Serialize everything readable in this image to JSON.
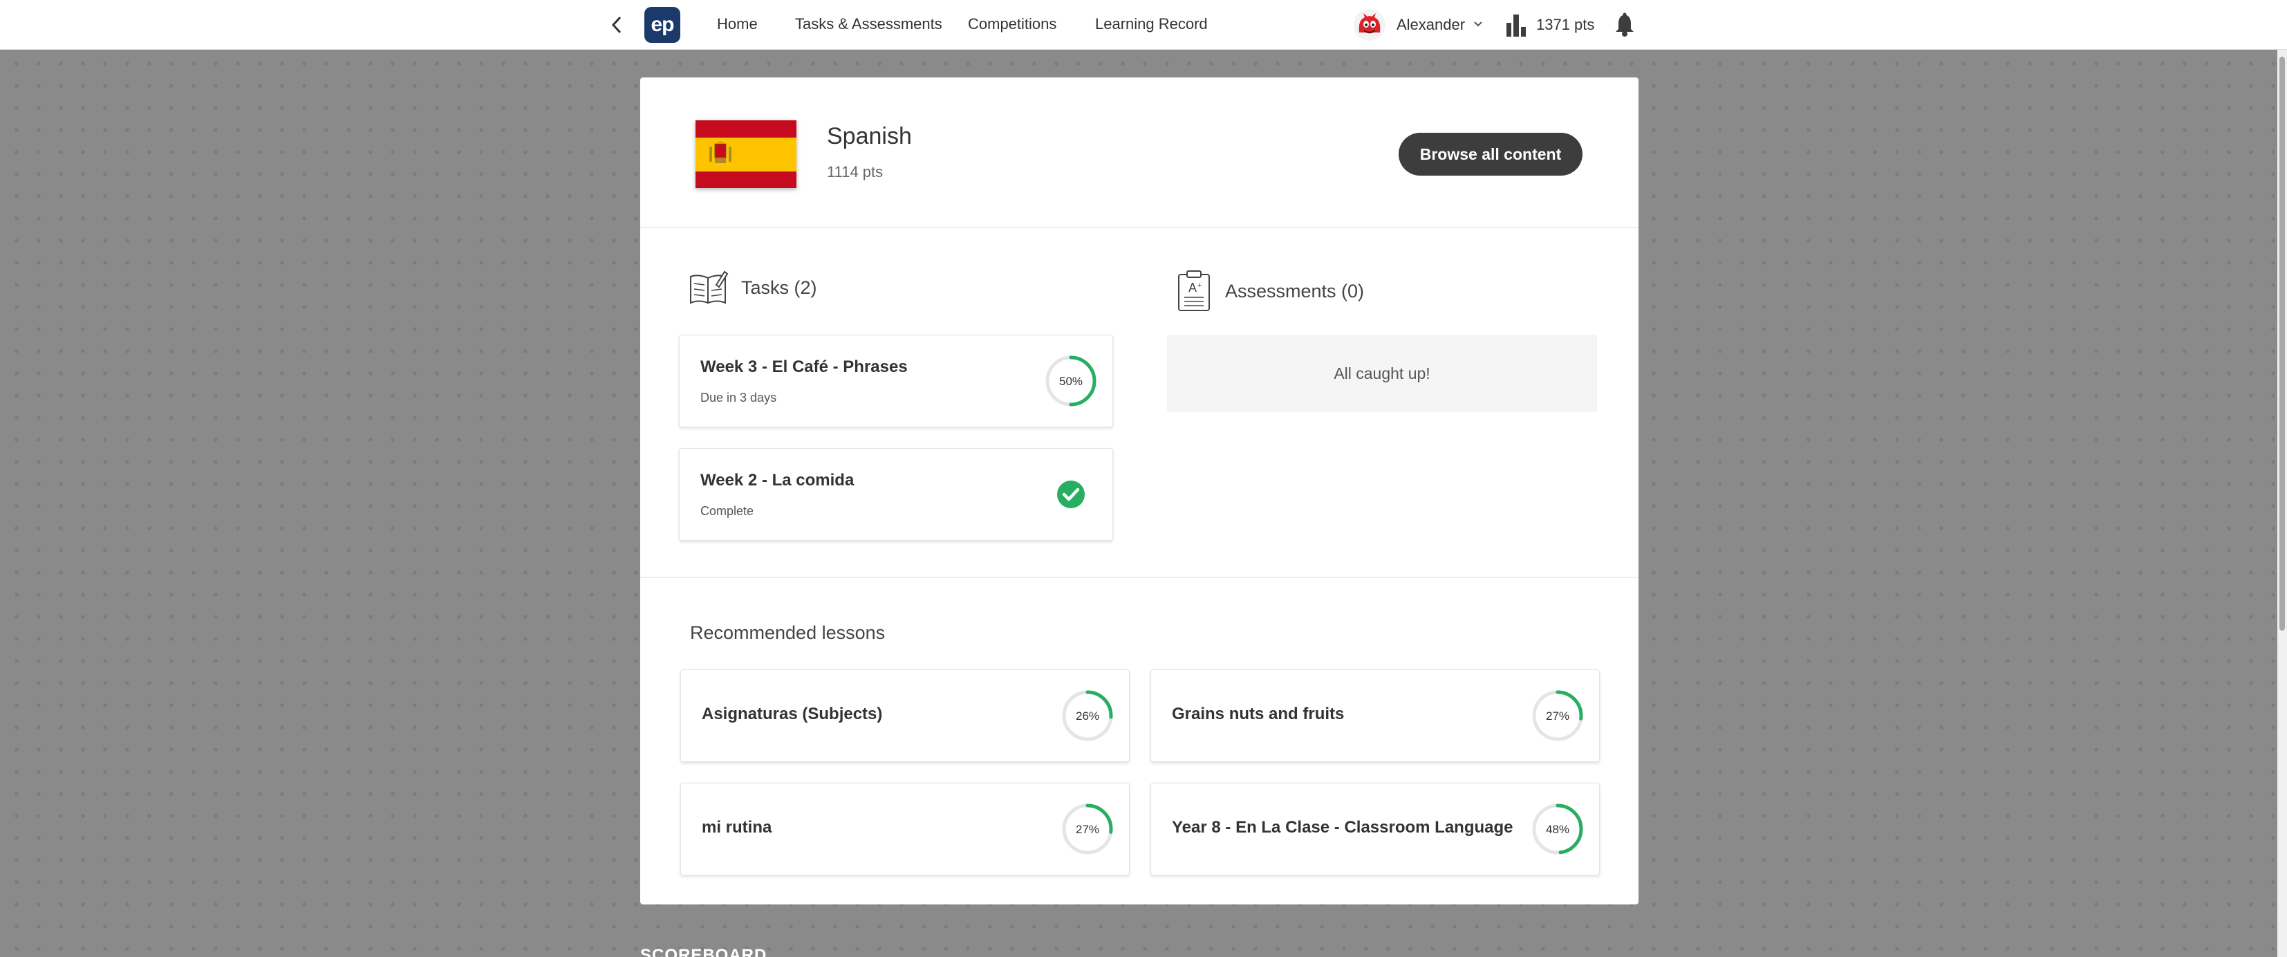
{
  "nav": {
    "logo_text": "ep",
    "links": [
      "Home",
      "Tasks & Assessments",
      "Competitions",
      "Learning Record"
    ],
    "user_name": "Alexander",
    "points": "1371 pts"
  },
  "subject": {
    "name": "Spanish",
    "points": "1114 pts",
    "browse_label": "Browse all content"
  },
  "tasks": {
    "heading": "Tasks (2)",
    "items": [
      {
        "title": "Week 3 - El Café - Phrases",
        "status": "Due in 3 days",
        "progress_label": "50%",
        "progress": 0.5
      },
      {
        "title": "Week 2 - La comida",
        "status": "Complete",
        "complete": true
      }
    ]
  },
  "assessments": {
    "heading": "Assessments (0)",
    "empty_text": "All caught up!"
  },
  "recommended": {
    "heading": "Recommended lessons",
    "items": [
      {
        "title": "Asignaturas (Subjects)",
        "progress_label": "26%",
        "progress": 0.26
      },
      {
        "title": "Grains nuts and fruits",
        "progress_label": "27%",
        "progress": 0.27
      },
      {
        "title": "mi rutina",
        "progress_label": "27%",
        "progress": 0.27
      },
      {
        "title": "Year 8 - En La Clase - Classroom Language",
        "progress_label": "48%",
        "progress": 0.48
      }
    ]
  },
  "footer_peek": "SCOREBOARD",
  "colors": {
    "accent_green": "#27ae60",
    "ring_track": "#e5e5e5",
    "nav_logo": "#1b3a6b",
    "button_dark": "#3d3d3d"
  }
}
